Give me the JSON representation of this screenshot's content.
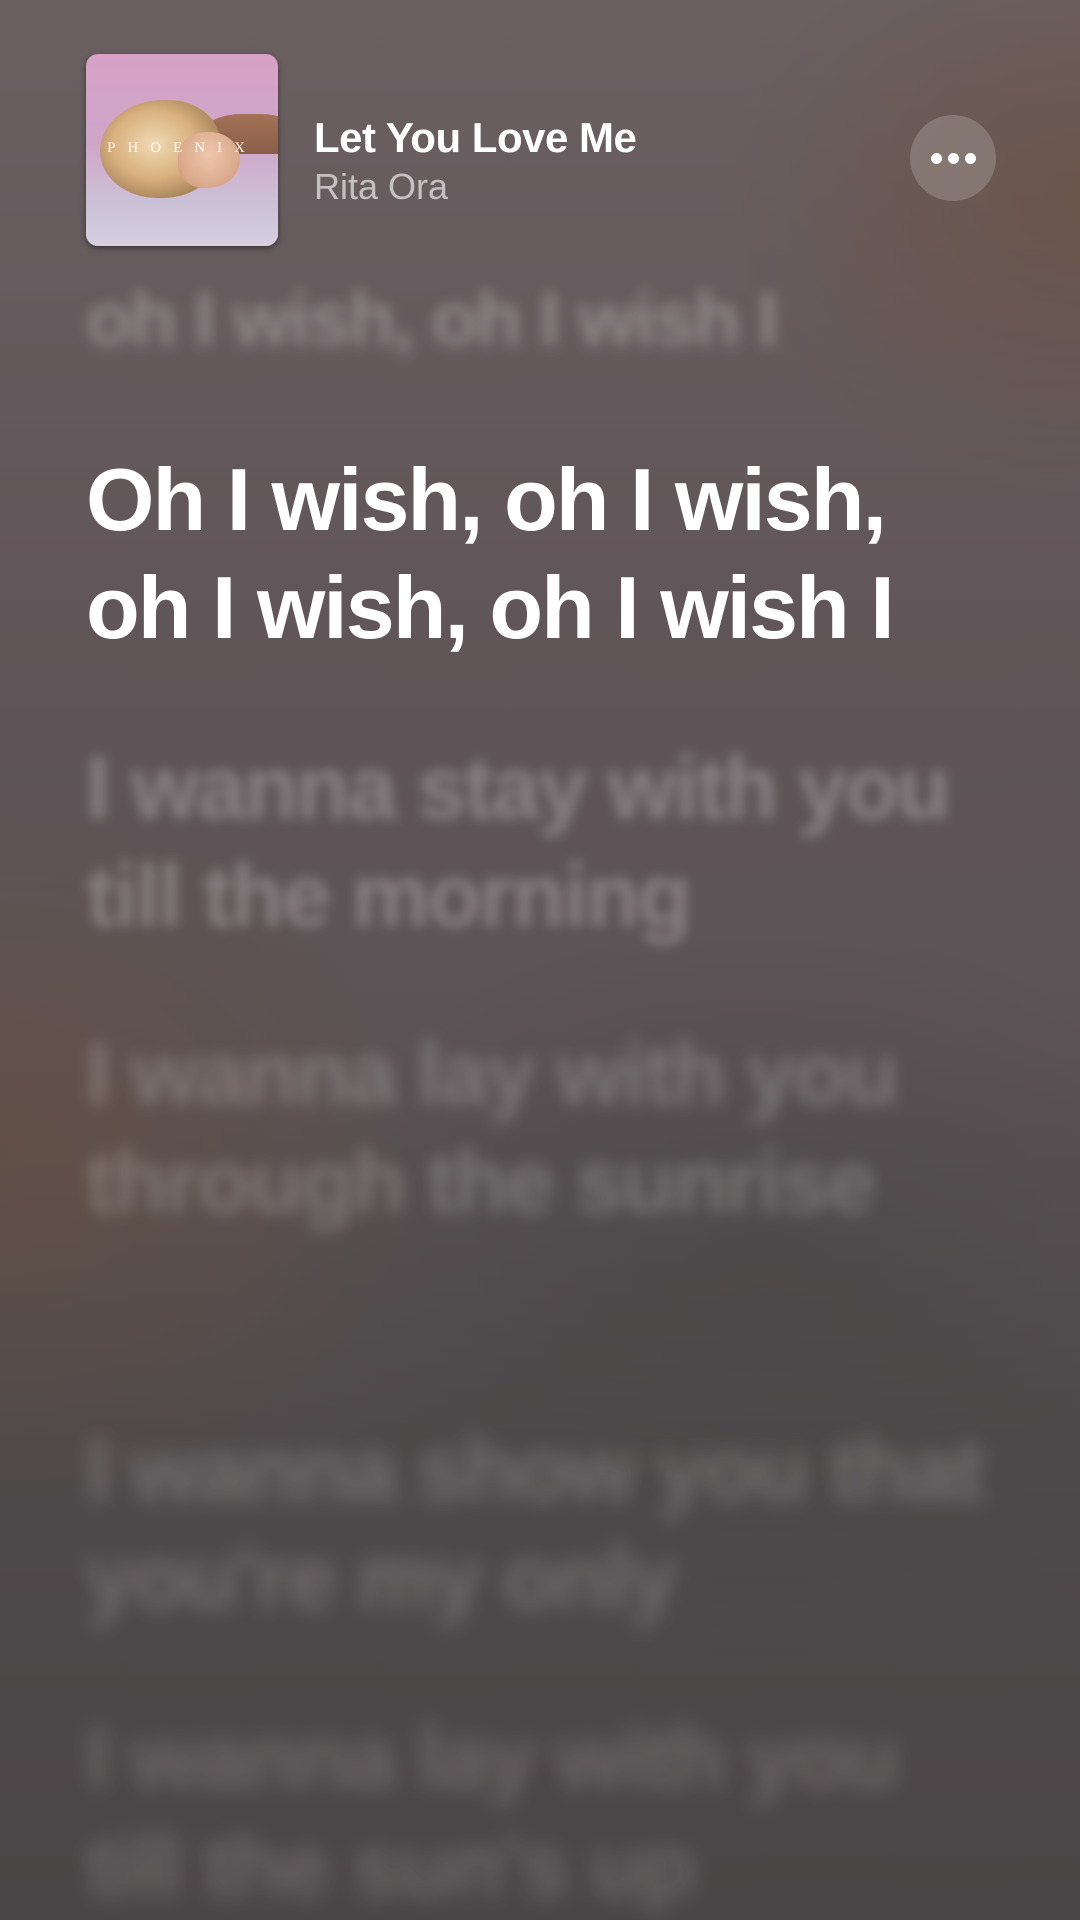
{
  "now_playing": {
    "title": "Let You Love Me",
    "artist": "Rita Ora",
    "album_art_text": "PHOENIX",
    "more_icon": "ellipsis-icon"
  },
  "lyrics": {
    "previous_line": "oh I wish, oh I wish I",
    "current_line": "Oh I wish, oh I wish, oh I wish, oh I wish I",
    "upcoming_lines": [
      "I wanna stay with you till the morning",
      "I wanna lay with you through the sunrise",
      "I wanna show you that you're my only",
      "I wanna lay with you till the sun's up"
    ]
  },
  "colors": {
    "current_lyric": "#ffffff",
    "dimmed_lyric": "rgba(255,255,255,0.26)",
    "artist_text": "rgba(255,255,255,0.62)"
  }
}
